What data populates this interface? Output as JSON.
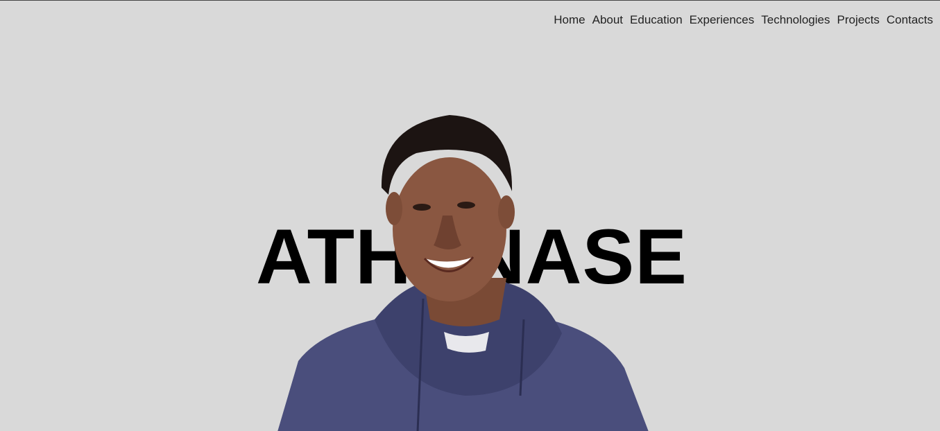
{
  "nav": {
    "items": [
      {
        "label": "Home"
      },
      {
        "label": "About"
      },
      {
        "label": "Education"
      },
      {
        "label": "Experiences"
      },
      {
        "label": "Technologies"
      },
      {
        "label": "Projects"
      },
      {
        "label": "Contacts"
      }
    ]
  },
  "hero": {
    "name": "ATHANASE",
    "portrait_icon": "person-photo"
  },
  "colors": {
    "background": "#d9d9d9",
    "text": "#000000",
    "hoodie": "#4a4e7c"
  }
}
